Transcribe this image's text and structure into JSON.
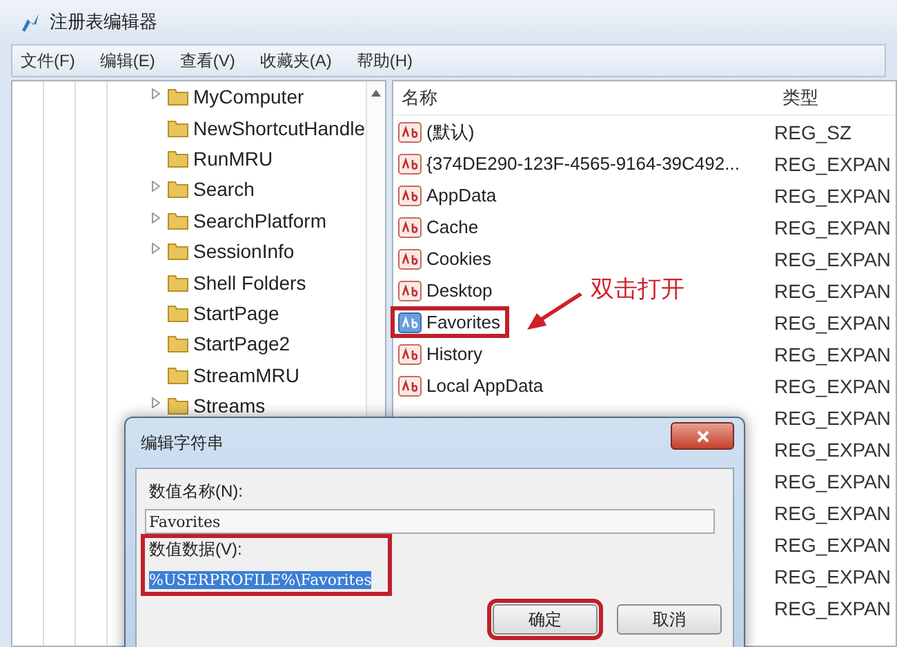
{
  "window": {
    "title": "注册表编辑器"
  },
  "menu": [
    "文件(F)",
    "编辑(E)",
    "查看(V)",
    "收藏夹(A)",
    "帮助(H)"
  ],
  "tree": {
    "items": [
      {
        "label": "MyComputer",
        "expandable": true
      },
      {
        "label": "NewShortcutHandle",
        "expandable": false
      },
      {
        "label": "RunMRU",
        "expandable": false
      },
      {
        "label": "Search",
        "expandable": true
      },
      {
        "label": "SearchPlatform",
        "expandable": true
      },
      {
        "label": "SessionInfo",
        "expandable": true
      },
      {
        "label": "Shell Folders",
        "expandable": false
      },
      {
        "label": "StartPage",
        "expandable": false
      },
      {
        "label": "StartPage2",
        "expandable": false
      },
      {
        "label": "StreamMRU",
        "expandable": false
      },
      {
        "label": "Streams",
        "expandable": true
      }
    ]
  },
  "list": {
    "columns": [
      "名称",
      "类型"
    ],
    "rows": [
      {
        "name": "(默认)",
        "type": "REG_SZ",
        "selected": false,
        "marked": false
      },
      {
        "name": "{374DE290-123F-4565-9164-39C492...",
        "type": "REG_EXPAN",
        "selected": false,
        "marked": false
      },
      {
        "name": "AppData",
        "type": "REG_EXPAN",
        "selected": false,
        "marked": false
      },
      {
        "name": "Cache",
        "type": "REG_EXPAN",
        "selected": false,
        "marked": false
      },
      {
        "name": "Cookies",
        "type": "REG_EXPAN",
        "selected": false,
        "marked": false
      },
      {
        "name": "Desktop",
        "type": "REG_EXPAN",
        "selected": false,
        "marked": false
      },
      {
        "name": "Favorites",
        "type": "REG_EXPAN",
        "selected": true,
        "marked": true
      },
      {
        "name": "History",
        "type": "REG_EXPAN",
        "selected": false,
        "marked": false
      },
      {
        "name": "Local AppData",
        "type": "REG_EXPAN",
        "selected": false,
        "marked": false
      },
      {
        "type": "REG_EXPAN"
      },
      {
        "type": "REG_EXPAN"
      },
      {
        "type": "REG_EXPAN"
      },
      {
        "type": "REG_EXPAN"
      },
      {
        "type": "REG_EXPAN"
      },
      {
        "type": "REG_EXPAN"
      },
      {
        "type": "REG_EXPAN"
      }
    ]
  },
  "annotation": {
    "text": "双击打开"
  },
  "dialog": {
    "title": "编辑字符串",
    "fields": [
      {
        "label": "数值名称(N):",
        "value": "Favorites",
        "selected": false,
        "marked": false
      },
      {
        "label": "数值数据(V):",
        "value": "%USERPROFILE%\\Favorites",
        "selected": true,
        "marked": true
      }
    ],
    "buttons": [
      {
        "label": "确定",
        "marked": true
      },
      {
        "label": "取消",
        "marked": false
      }
    ]
  }
}
